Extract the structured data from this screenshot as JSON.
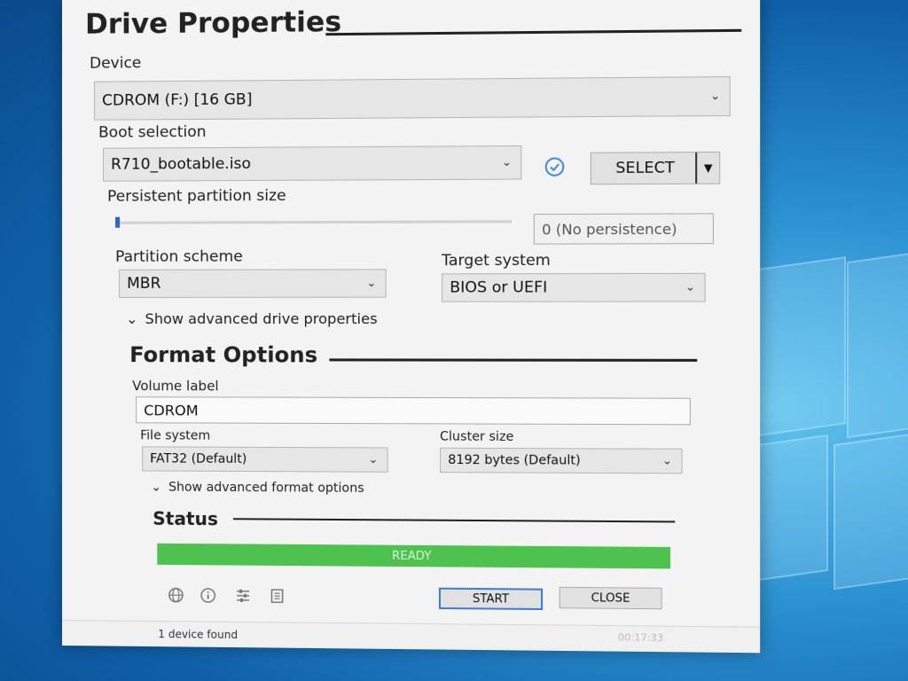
{
  "sections": {
    "drive": "Drive Properties",
    "format": "Format Options",
    "status": "Status"
  },
  "device": {
    "label": "Device",
    "value": "CDROM (F:) [16 GB]"
  },
  "boot": {
    "label": "Boot selection",
    "value": "R710_bootable.iso",
    "select_label": "SELECT"
  },
  "persistent": {
    "label": "Persistent partition size",
    "value": "0 (No persistence)",
    "slider_fraction": 0
  },
  "partition": {
    "label": "Partition scheme",
    "value": "MBR"
  },
  "target": {
    "label": "Target system",
    "value": "BIOS or UEFI"
  },
  "adv_drive": "Show advanced drive properties",
  "volume": {
    "label": "Volume label",
    "value": "CDROM"
  },
  "filesystem": {
    "label": "File system",
    "value": "FAT32 (Default)"
  },
  "cluster": {
    "label": "Cluster size",
    "value": "8192 bytes (Default)"
  },
  "adv_format": "Show advanced format options",
  "progress": {
    "text": "READY",
    "value": 1.0,
    "color": "#4ec24e"
  },
  "buttons": {
    "start": "START",
    "close": "CLOSE"
  },
  "footer": {
    "devices": "1 device found",
    "timer": "00:17:33"
  },
  "colors": {
    "accent": "#3c7fd1",
    "check": "#3a8ad8"
  },
  "icons": [
    "globe-icon",
    "info-icon",
    "settings-sliders-icon",
    "log-icon",
    "check-circle-icon",
    "chevron-down-icon"
  ]
}
